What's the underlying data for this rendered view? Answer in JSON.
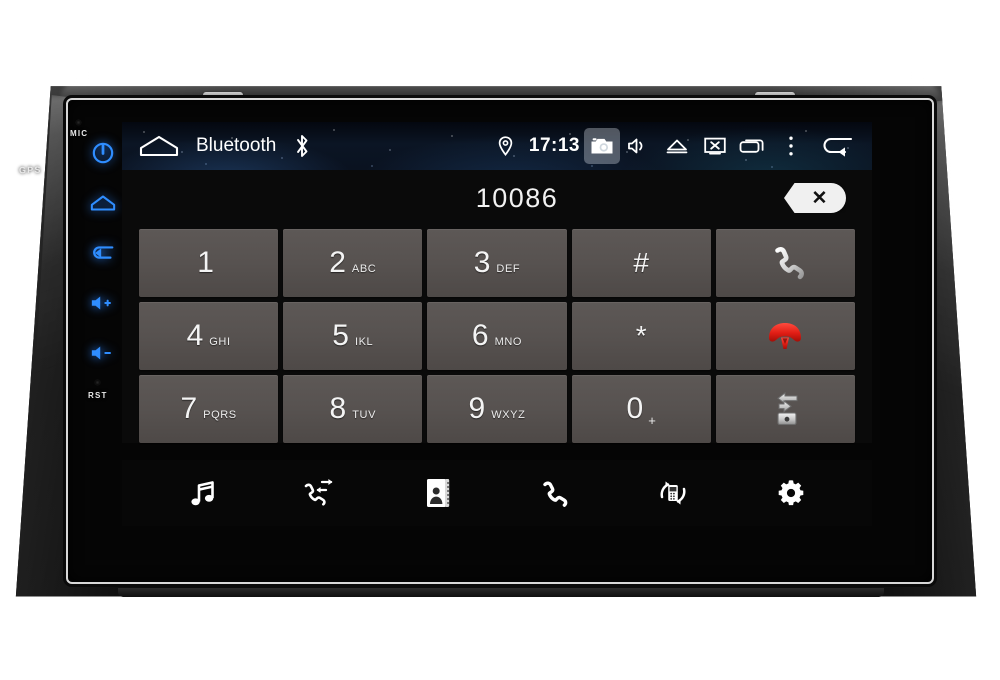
{
  "device": {
    "bezel_labels": {
      "gps": "GPS",
      "mic": "MIC",
      "reset": "RST"
    },
    "hardware_keys": [
      {
        "name": "power",
        "icon": "power-icon"
      },
      {
        "name": "home",
        "icon": "home-icon"
      },
      {
        "name": "back",
        "icon": "back-icon"
      },
      {
        "name": "volume-up",
        "icon": "volume-up-icon"
      },
      {
        "name": "volume-down",
        "icon": "volume-down-icon"
      }
    ],
    "accent_blue": "#2e8bff"
  },
  "statusbar": {
    "home_icon": "home-outline-icon",
    "title": "Bluetooth",
    "bluetooth_icon": "bluetooth-icon",
    "location_icon": "location-pin-icon",
    "time": "17:13",
    "right_icons": [
      {
        "name": "camera-icon",
        "highlighted": true
      },
      {
        "name": "mute-speaker-icon",
        "highlighted": false
      },
      {
        "name": "eject-icon",
        "highlighted": false
      },
      {
        "name": "screen-off-icon",
        "highlighted": false
      },
      {
        "name": "recent-apps-icon",
        "highlighted": false
      },
      {
        "name": "overflow-menu-icon",
        "highlighted": false
      },
      {
        "name": "back-arrow-icon",
        "highlighted": false
      }
    ]
  },
  "dialer": {
    "number": "10086",
    "backspace_label": "✕",
    "keys": [
      {
        "digit": "1",
        "letters": ""
      },
      {
        "digit": "2",
        "letters": "ABC"
      },
      {
        "digit": "3",
        "letters": "DEF"
      },
      {
        "digit": "#",
        "letters": "",
        "symbol": true
      },
      {
        "action": "call",
        "icon": "phone-call-icon"
      },
      {
        "digit": "4",
        "letters": "GHI"
      },
      {
        "digit": "5",
        "letters": "IKL"
      },
      {
        "digit": "6",
        "letters": "MNO"
      },
      {
        "digit": "*",
        "letters": "",
        "symbol": true
      },
      {
        "action": "hangup",
        "icon": "phone-hangup-icon"
      },
      {
        "digit": "7",
        "letters": "PQRS"
      },
      {
        "digit": "8",
        "letters": "TUV"
      },
      {
        "digit": "9",
        "letters": "WXYZ"
      },
      {
        "digit": "0",
        "letters": "+"
      },
      {
        "action": "transfer-audio",
        "icon": "audio-transfer-icon"
      }
    ]
  },
  "toolbar": {
    "items": [
      {
        "name": "bluetooth-music",
        "icon": "music-note-icon"
      },
      {
        "name": "call-log",
        "icon": "call-log-icon"
      },
      {
        "name": "contacts",
        "icon": "contacts-book-icon"
      },
      {
        "name": "dialpad",
        "icon": "phone-icon"
      },
      {
        "name": "sync-phonebook",
        "icon": "sync-phone-icon"
      },
      {
        "name": "settings",
        "icon": "gear-icon"
      }
    ]
  }
}
